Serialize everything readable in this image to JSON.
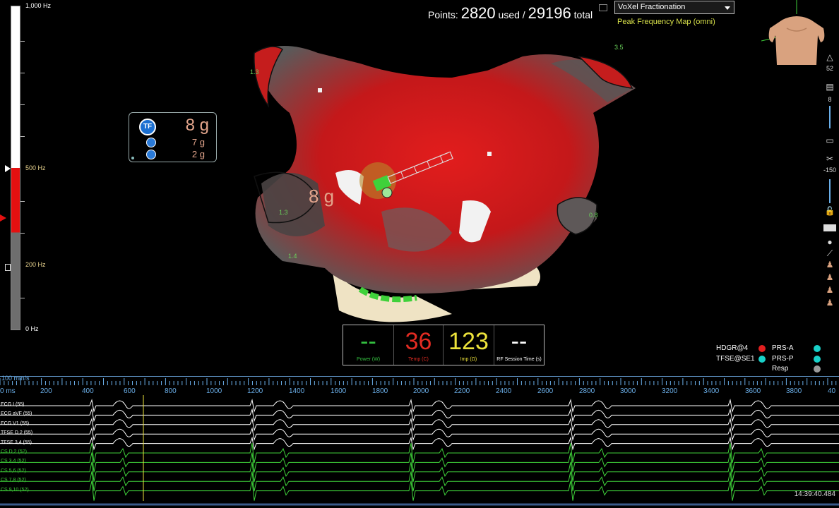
{
  "header": {
    "points_prefix": "Points:",
    "points_used": "2820",
    "points_used_label": "used /",
    "points_total": "29196",
    "points_total_label": "total",
    "map_type_select": "VoXel Fractionation",
    "map_subtitle": "Peak Frequency Map (omni)"
  },
  "frequency_scale": {
    "top_label": "1,000 Hz",
    "upper_label": "500 Hz",
    "lower_label": "200 Hz",
    "bottom_label": "0 Hz"
  },
  "force_widget": {
    "badge": "TF",
    "total_force": "8 g",
    "axial_force": "7 g",
    "lateral_force": "2 g"
  },
  "anatomy": {
    "force_label": "8 g",
    "region_labels": [
      "1.3",
      "3.5",
      "1.3",
      "1.4",
      "0.8"
    ]
  },
  "rf_panel": {
    "power": {
      "value": "--",
      "label": "Power (W)",
      "color": "#34c140"
    },
    "temp": {
      "value": "36",
      "label": "Temp (C)",
      "color": "#e22b22"
    },
    "imp": {
      "value": "123",
      "label": "Imp (Ω)",
      "color": "#ede33b"
    },
    "session": {
      "value": "--",
      "label": "RF Session Time (s)",
      "color": "#ffffff"
    }
  },
  "toolbar": {
    "value_top": "52",
    "value_mid": "8",
    "value_low": "-150"
  },
  "legend": {
    "row1_left": "HDGR@4",
    "row1_right": "PRS-A",
    "row2_left": "TFSE@SE1",
    "row2_right": "PRS-P",
    "row3_right": "Resp",
    "colors": {
      "red": "#e21f1f",
      "cyan": "#19d0c8",
      "gray": "#9a9a9a"
    }
  },
  "timeline": {
    "scale_label": "100 mm/s",
    "labels": [
      "0 ms",
      "200",
      "400",
      "600",
      "800",
      "1000",
      "1200",
      "1400",
      "1600",
      "1800",
      "2000",
      "2200",
      "2400",
      "2600",
      "2800",
      "3000",
      "3200",
      "3400",
      "3600",
      "3800",
      "40"
    ]
  },
  "channels": [
    {
      "label": "ECG I (55)",
      "color": "#ffffff"
    },
    {
      "label": "ECG aVF (55)",
      "color": "#ffffff"
    },
    {
      "label": "ECG V1 (55)",
      "color": "#ffffff"
    },
    {
      "label": "TFSE D,2 (55)",
      "color": "#ffffff"
    },
    {
      "label": "TFSE 3,4 (55)",
      "color": "#ffffff"
    },
    {
      "label": "CS D,2 (52)",
      "color": "#3fd13a"
    },
    {
      "label": "CS 3,4 (52)",
      "color": "#3fd13a"
    },
    {
      "label": "CS 5,6 (52)",
      "color": "#3fd13a"
    },
    {
      "label": "CS 7,8 (52)",
      "color": "#3fd13a"
    },
    {
      "label": "CS 9,10 (52)",
      "color": "#3fd13a"
    }
  ],
  "clock": "14:39:40.484"
}
